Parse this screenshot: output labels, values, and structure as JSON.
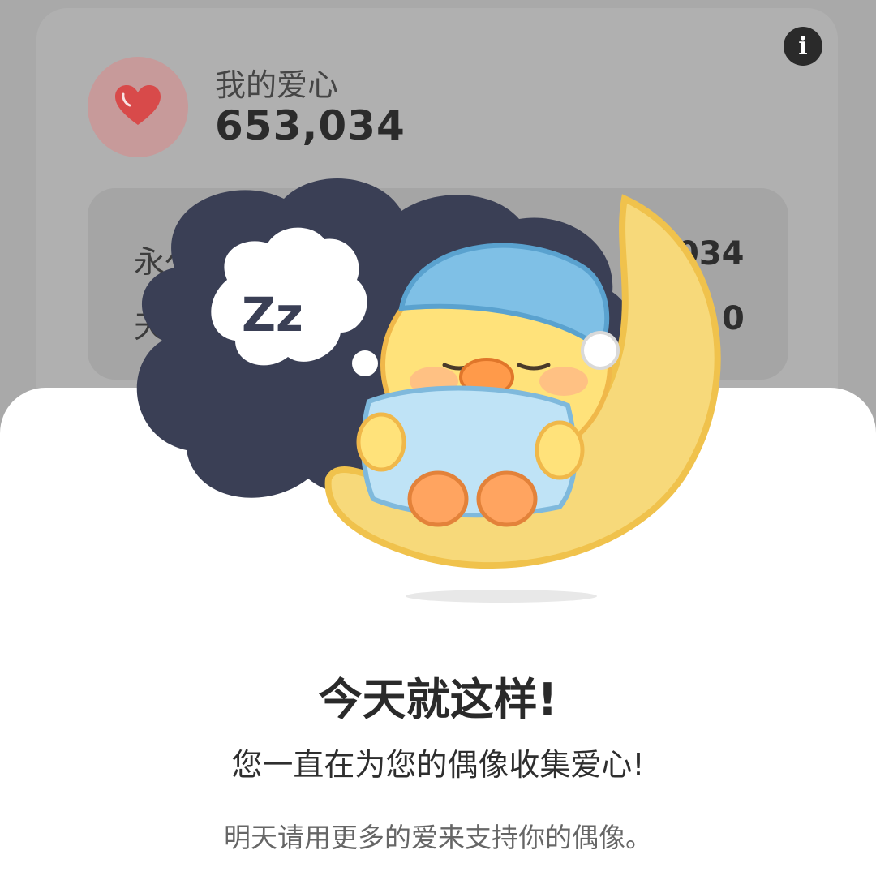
{
  "card": {
    "title": "我的爱心",
    "count": "653,034",
    "rows": [
      {
        "label": "永久爱",
        "value": "034"
      },
      {
        "label": "天",
        "value": "0"
      }
    ],
    "info_icon": "info-icon",
    "heart_icon": "heart-icon"
  },
  "sheet": {
    "title": "今天就这样!",
    "subtitle": "您一直在为您的偶像收集爱心!",
    "note": "明天请用更多的爱来支持你的偶像。",
    "illustration_text": "Zz"
  },
  "colors": {
    "heart": "#d84a4a",
    "moon": "#f7d97a",
    "cloud": "#3a3f55",
    "cap": "#7fc0e6"
  }
}
